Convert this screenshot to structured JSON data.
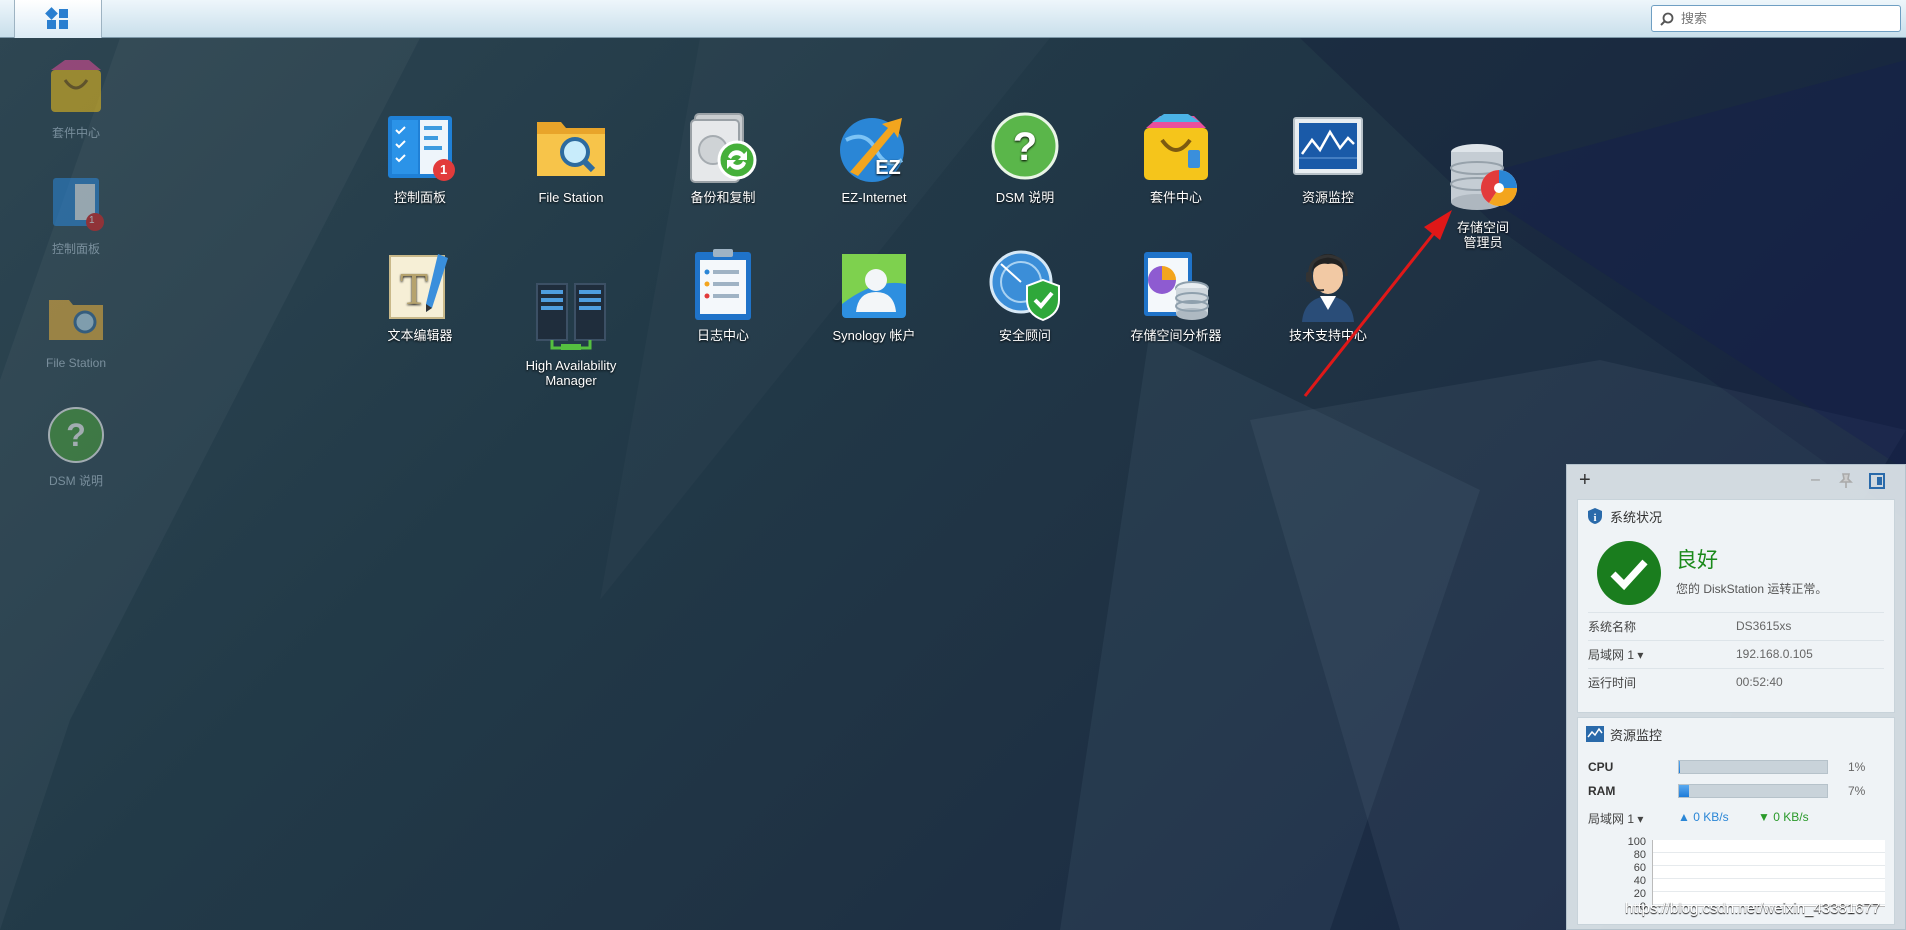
{
  "taskbar": {
    "search_placeholder": "搜索"
  },
  "desktop_shortcuts": [
    {
      "label": "套件中心",
      "icon": "package-center-icon"
    },
    {
      "label": "控制面板",
      "icon": "control-panel-icon",
      "badge": "1"
    },
    {
      "label": "File Station",
      "icon": "folder-search-icon"
    },
    {
      "label": "DSM 说明",
      "icon": "help-icon"
    }
  ],
  "launcher": {
    "apps": [
      {
        "label": "控制面板",
        "icon": "control-panel-icon",
        "badge": "1"
      },
      {
        "label": "File Station",
        "icon": "folder-search-icon"
      },
      {
        "label": "备份和复制",
        "icon": "backup-sync-icon"
      },
      {
        "label": "EZ-Internet",
        "icon": "ez-internet-icon",
        "icon_text": "EZ"
      },
      {
        "label": "DSM 说明",
        "icon": "help-icon"
      },
      {
        "label": "套件中心",
        "icon": "package-center-icon"
      },
      {
        "label": "资源监控",
        "icon": "resource-monitor-icon"
      },
      {
        "label": "存储空间\n管理员",
        "icon": "storage-manager-icon"
      },
      {
        "label": "文本编辑器",
        "icon": "text-editor-icon"
      },
      {
        "label": "High Availability\nManager",
        "icon": "server-ha-icon"
      },
      {
        "label": "日志中心",
        "icon": "log-center-icon"
      },
      {
        "label": "Synology 帐户",
        "icon": "account-icon"
      },
      {
        "label": "安全顾问",
        "icon": "security-shield-icon"
      },
      {
        "label": "存储空间分析器",
        "icon": "storage-analyzer-icon"
      },
      {
        "label": "技术支持中心",
        "icon": "support-agent-icon"
      }
    ]
  },
  "widget": {
    "toolbar": {
      "add": "+",
      "minimize": "–"
    },
    "system_health": {
      "title": "系统状况",
      "status": "良好",
      "message": "您的 DiskStation 运转正常。",
      "rows": [
        {
          "key": "系统名称",
          "value": "DS3615xs"
        },
        {
          "key": "局域网 1 ▾",
          "value": "192.168.0.105"
        },
        {
          "key": "运行时间",
          "value": "00:52:40"
        }
      ]
    },
    "resource_monitor": {
      "title": "资源监控",
      "cpu_label": "CPU",
      "cpu_value": "1%",
      "cpu_fraction": 0.01,
      "ram_label": "RAM",
      "ram_value": "7%",
      "ram_fraction": 0.07,
      "network_label": "局域网 1 ▾",
      "upload": "0 KB/s",
      "download": "0 KB/s",
      "chart_ticks": [
        "100",
        "80",
        "60",
        "40",
        "20",
        "0"
      ]
    }
  },
  "watermark": "https://blog.csdn.net/weixin_43381677",
  "colors": {
    "accent": "#1f7bd8",
    "health_green": "#1a8a1a",
    "annotation_arrow": "#e01818"
  }
}
